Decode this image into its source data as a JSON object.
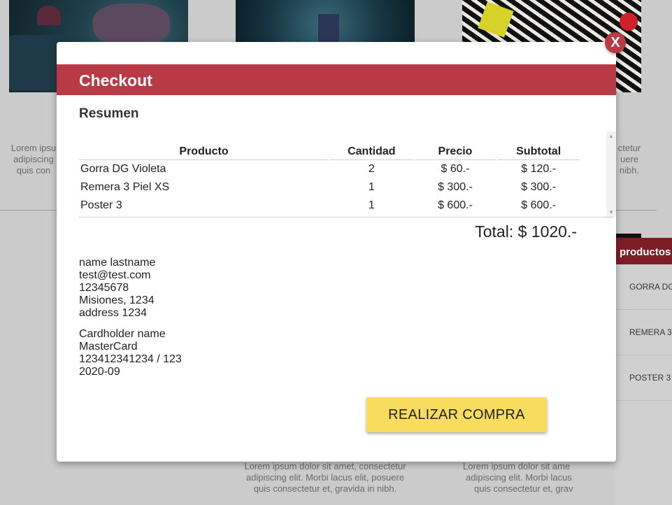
{
  "background": {
    "card_text_left": [
      "Lorem ipsu",
      "adipiscing",
      "quis con"
    ],
    "card_text_right_top": [
      "ctetur",
      "uere",
      "nibh."
    ],
    "card_text_bottom_center": [
      "Lorem ipsum dolor sit amet, consectetur",
      "adipiscing elit. Morbi lacus elit, posuere",
      "quis consectetur et, gravida in nibh."
    ],
    "card_text_bottom_right": [
      "Lorem ipsum dolor sit ame",
      "adipiscing elit. Morbi lacus",
      "quis consectetur et, grav"
    ]
  },
  "cart": {
    "header": "productos",
    "items": [
      "GORRA DG",
      "REMERA 3",
      "POSTER 3"
    ]
  },
  "modal": {
    "title": "Checkout",
    "close_label": "X",
    "summary_title": "Resumen",
    "table": {
      "headers": [
        "Producto",
        "Cantidad",
        "Precio",
        "Subtotal"
      ],
      "rows": [
        [
          "Gorra DG Violeta",
          "2",
          "$ 60.-",
          "$ 120.-"
        ],
        [
          "Remera 3 Piel XS",
          "1",
          "$ 300.-",
          "$ 300.-"
        ],
        [
          "Poster 3",
          "1",
          "$ 600.-",
          "$ 600.-"
        ]
      ]
    },
    "total": "Total: $ 1020.-",
    "customer": {
      "name": "name lastname",
      "email": "test@test.com",
      "phone": "12345678",
      "location": "Misiones, 1234",
      "address": "address 1234"
    },
    "payment": {
      "cardholder": "Cardholder name",
      "brand": "MasterCard",
      "card_number": "123412341234 / 123",
      "expiry": "2020-09"
    },
    "buy_button": "REALIZAR COMPRA"
  },
  "colors": {
    "accent": "#b93a44",
    "button": "#f7dc5d",
    "overlay": "#cbcbcb"
  }
}
